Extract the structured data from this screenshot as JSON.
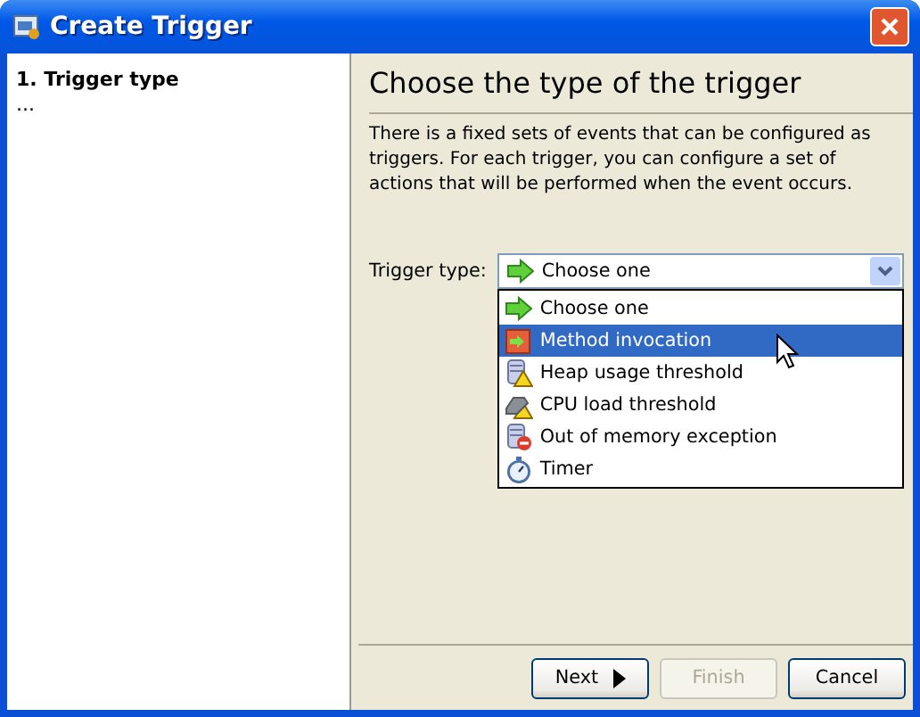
{
  "window": {
    "title": "Create Trigger"
  },
  "steps": [
    {
      "label": "1. Trigger type",
      "selected": true
    },
    {
      "label": "...",
      "selected": false
    }
  ],
  "header": {
    "title": "Choose the type of the trigger",
    "description": "There is a fixed sets of events that can be configured as triggers. For each trigger, you can configure a set of actions that will be performed when the event occurs."
  },
  "trigger_type": {
    "label": "Trigger type:",
    "value": "Choose one",
    "expanded": true,
    "options": [
      {
        "label": "Choose one",
        "kind": "arrow",
        "highlighted": false
      },
      {
        "label": "Method invocation",
        "kind": "method",
        "highlighted": true
      },
      {
        "label": "Heap usage threshold",
        "kind": "heap",
        "highlighted": false
      },
      {
        "label": "CPU load threshold",
        "kind": "cpu",
        "highlighted": false
      },
      {
        "label": "Out of memory exception",
        "kind": "oom",
        "highlighted": false
      },
      {
        "label": "Timer",
        "kind": "timer",
        "highlighted": false
      }
    ]
  },
  "buttons": [
    {
      "label": "Next",
      "kind": "next",
      "disabled": false
    },
    {
      "label": "Finish",
      "kind": "plain",
      "disabled": true
    },
    {
      "label": "Cancel",
      "kind": "plain",
      "disabled": false
    }
  ]
}
